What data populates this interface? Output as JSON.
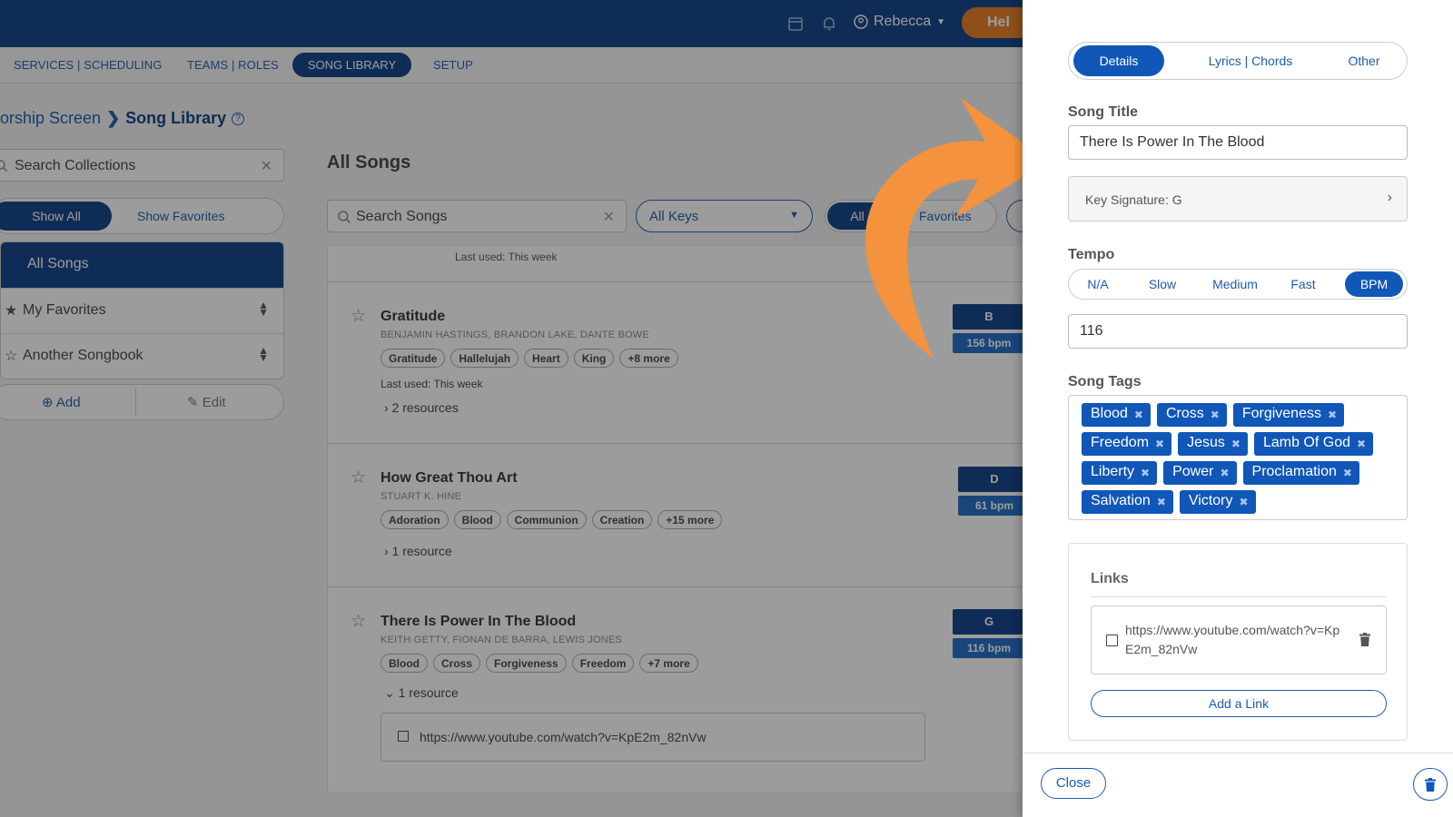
{
  "topbar": {
    "user_name": "Rebecca",
    "help_label": "Hel"
  },
  "subnav": {
    "items": [
      "SERVICES | SCHEDULING",
      "TEAMS | ROLES",
      "SONG LIBRARY",
      "SETUP"
    ],
    "active": "SONG LIBRARY"
  },
  "breadcrumb": {
    "parent": "orship Screen",
    "current": "Song Library"
  },
  "collections": {
    "search_placeholder": "Search Collections",
    "show_all": "Show All",
    "show_favorites": "Show Favorites",
    "items": [
      {
        "label": "All Songs"
      },
      {
        "label": "My Favorites"
      },
      {
        "label": "Another Songbook"
      }
    ],
    "add_label": "Add",
    "edit_label": "Edit"
  },
  "songs_view": {
    "title": "All Songs",
    "search_placeholder": "Search Songs",
    "keys_filter": "All Keys",
    "filter_all": "All",
    "filter_favorites": "Favorites",
    "partial_last_used": "Last used: This week",
    "songs": [
      {
        "title": "Gratitude",
        "authors": "BENJAMIN HASTINGS, BRANDON LAKE, DANTE BOWE",
        "tags": [
          "Gratitude",
          "Hallelujah",
          "Heart",
          "King",
          "+8 more"
        ],
        "last_used": "Last used: This week",
        "resources": "2 resources",
        "key": "B",
        "bpm": "156 bpm"
      },
      {
        "title": "How Great Thou Art",
        "authors": "STUART K. HINE",
        "tags": [
          "Adoration",
          "Blood",
          "Communion",
          "Creation",
          "+15 more"
        ],
        "resources": "1 resource",
        "key": "D",
        "bpm": "61 bpm"
      },
      {
        "title": "There Is Power In The Blood",
        "authors": "KEITH GETTY, FIONAN DE BARRA, LEWIS JONES",
        "tags": [
          "Blood",
          "Cross",
          "Forgiveness",
          "Freedom",
          "+7 more"
        ],
        "resources": "1 resource",
        "resource_link": "https://www.youtube.com/watch?v=KpE2m_82nVw",
        "key": "G",
        "bpm": "116 bpm"
      }
    ]
  },
  "details": {
    "tabs": [
      "Details",
      "Lyrics | Chords",
      "Other"
    ],
    "active_tab": "Details",
    "song_title_label": "Song Title",
    "song_title_value": "There Is Power In The Blood",
    "key_signature": "Key Signature: G",
    "tempo_label": "Tempo",
    "tempo_options": [
      "N/A",
      "Slow",
      "Medium",
      "Fast",
      "BPM"
    ],
    "tempo_selected": "BPM",
    "bpm_value": "116",
    "tags_label": "Song Tags",
    "tags": [
      "Blood",
      "Cross",
      "Forgiveness",
      "Freedom",
      "Jesus",
      "Lamb Of God",
      "Liberty",
      "Power",
      "Proclamation",
      "Salvation",
      "Victory"
    ],
    "links_label": "Links",
    "link_url": "https://www.youtube.com/watch?v=KpE2m_82nVw",
    "add_link_label": "Add a Link",
    "close_label": "Close"
  },
  "colors": {
    "navy": "#0d3f87",
    "primary_blue": "#1057b8",
    "orange_arrow": "#f5923e",
    "help_orange": "#e87a22"
  }
}
